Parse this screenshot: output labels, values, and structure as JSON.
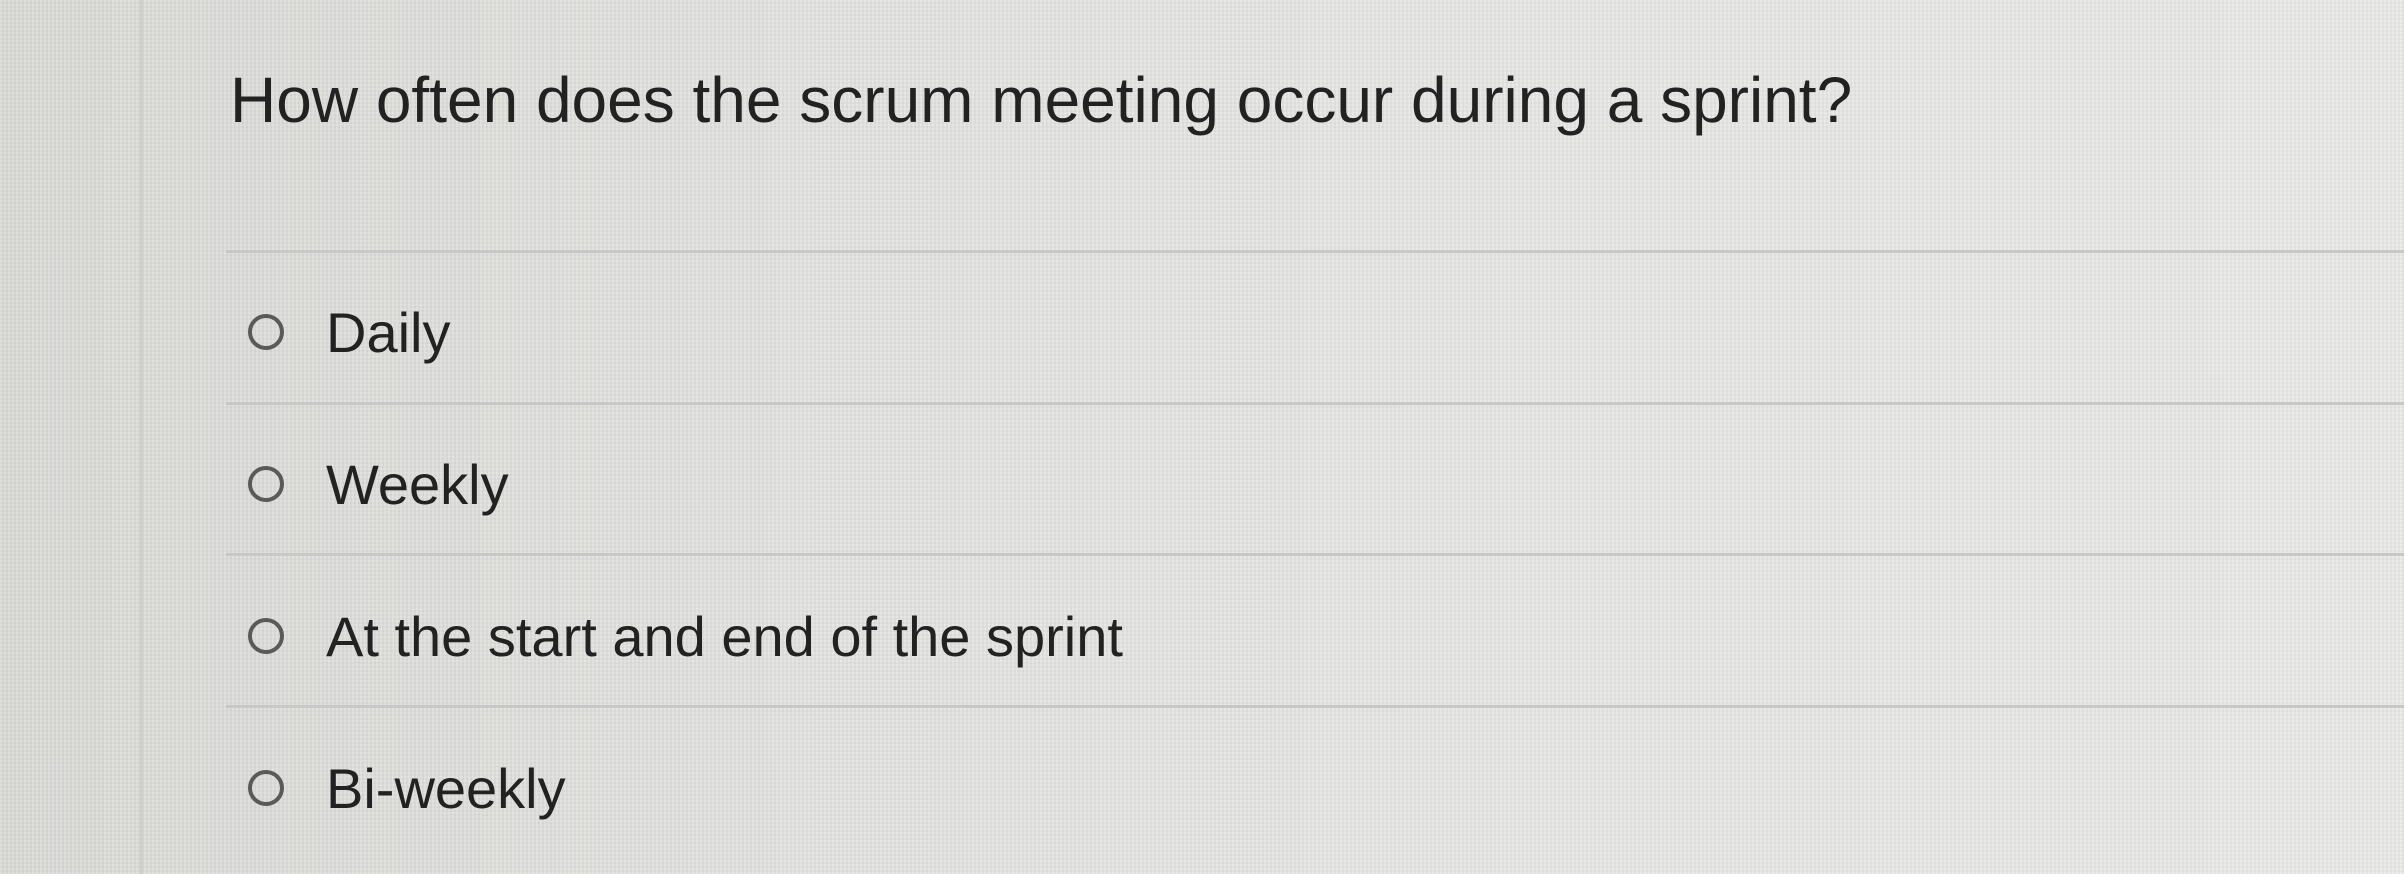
{
  "question": {
    "text": "How often does the scrum meeting occur during a sprint?"
  },
  "options": [
    {
      "label": "Daily",
      "selected": false
    },
    {
      "label": "Weekly",
      "selected": false
    },
    {
      "label": "At the start and end of the sprint",
      "selected": false
    },
    {
      "label": "Bi-weekly",
      "selected": false
    }
  ]
}
